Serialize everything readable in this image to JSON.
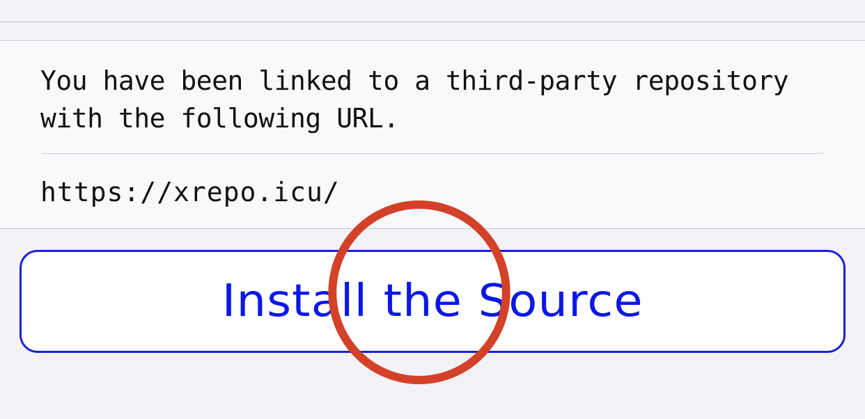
{
  "card": {
    "message": "You have been linked to a third-party repository with the following URL.",
    "url": "https://xrepo.icu/"
  },
  "actions": {
    "install_label": "Install the Source"
  },
  "colors": {
    "accent": "#0b18e6",
    "annotation": "#d24128",
    "background": "#f2f2f7"
  }
}
